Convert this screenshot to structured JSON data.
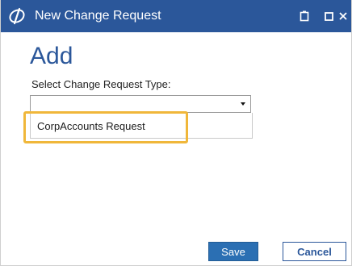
{
  "window": {
    "title": "New Change Request",
    "accent_color": "#2b579a",
    "highlight_color": "#f0b73a",
    "controls": [
      "restore-icon",
      "maximize-icon",
      "close-icon"
    ]
  },
  "main": {
    "heading": "Add",
    "field_label": "Select Change Request Type:",
    "select_value": "",
    "dropdown_options": [
      "CorpAccounts Request"
    ],
    "highlighted_option_index": 0
  },
  "footer": {
    "save_label": "Save",
    "cancel_label": "Cancel"
  }
}
